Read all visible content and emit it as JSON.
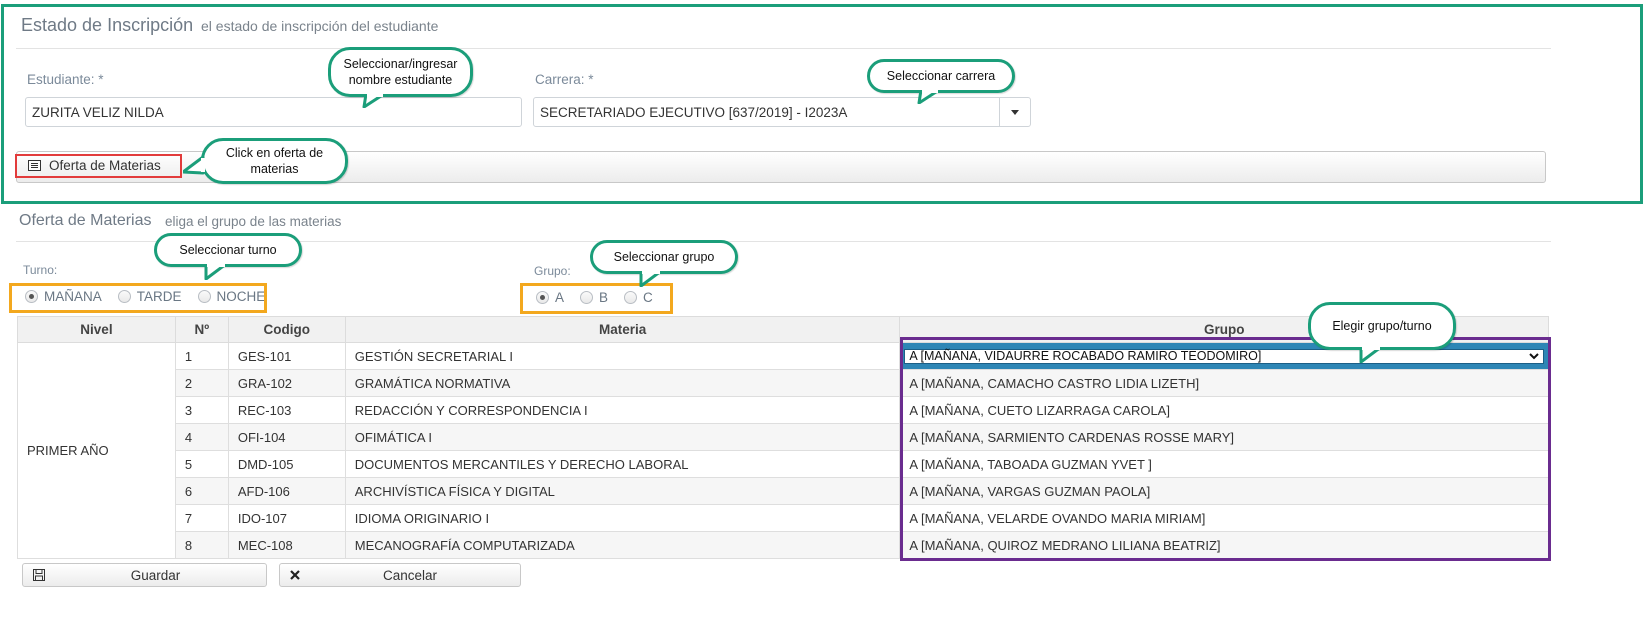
{
  "estado": {
    "title": "Estado de Inscripción",
    "subtitle": "el estado de inscripción del estudiante",
    "estudiante_label": "Estudiante: *",
    "estudiante_value": "ZURITA VELIZ NILDA",
    "carrera_label": "Carrera: *",
    "carrera_value": "SECRETARIADO EJECUTIVO [637/2019] - I2023A",
    "oferta_button": "Oferta de Materias"
  },
  "oferta": {
    "title": "Oferta de Materias",
    "subtitle": "eliga el grupo de las materias",
    "turno_label": "Turno:",
    "turnos": [
      "MAÑANA",
      "TARDE",
      "NOCHE"
    ],
    "turno_selected": "MAÑANA",
    "grupo_label": "Grupo:",
    "grupos": [
      "A",
      "B",
      "C"
    ],
    "grupo_selected": "A"
  },
  "table": {
    "headers": [
      "Nivel",
      "Nº",
      "Codigo",
      "Materia",
      "Grupo"
    ],
    "nivel": "PRIMER AÑO",
    "rows": [
      {
        "n": "1",
        "codigo": "GES-101",
        "materia": "GESTIÓN SECRETARIAL I",
        "grupo": "A [MAÑANA, VIDAURRE ROCABADO RAMIRO TEODOMIRO]"
      },
      {
        "n": "2",
        "codigo": "GRA-102",
        "materia": "GRAMÁTICA NORMATIVA",
        "grupo": "A [MAÑANA, CAMACHO CASTRO LIDIA LIZETH]"
      },
      {
        "n": "3",
        "codigo": "REC-103",
        "materia": "REDACCIÓN Y CORRESPONDENCIA I",
        "grupo": "A [MAÑANA, CUETO LIZARRAGA CAROLA]"
      },
      {
        "n": "4",
        "codigo": "OFI-104",
        "materia": "OFIMÁTICA I",
        "grupo": "A [MAÑANA, SARMIENTO CARDENAS ROSSE MARY]"
      },
      {
        "n": "5",
        "codigo": "DMD-105",
        "materia": "DOCUMENTOS MERCANTILES Y DERECHO LABORAL",
        "grupo": "A [MAÑANA, TABOADA GUZMAN YVET ]"
      },
      {
        "n": "6",
        "codigo": "AFD-106",
        "materia": "ARCHIVÍSTICA FÍSICA Y DIGITAL",
        "grupo": "A [MAÑANA, VARGAS GUZMAN PAOLA]"
      },
      {
        "n": "7",
        "codigo": "IDO-107",
        "materia": "IDIOMA ORIGINARIO I",
        "grupo": "A [MAÑANA, VELARDE OVANDO MARIA MIRIAM]"
      },
      {
        "n": "8",
        "codigo": "MEC-108",
        "materia": "MECANOGRAFÍA COMPUTARIZADA",
        "grupo": "A [MAÑANA, QUIROZ MEDRANO LILIANA BEATRIZ]"
      }
    ]
  },
  "actions": {
    "guardar": "Guardar",
    "cancelar": "Cancelar"
  },
  "callouts": {
    "estudiante": "Seleccionar/ingresar nombre estudiante",
    "carrera": "Seleccionar carrera",
    "oferta": "Click en oferta de materias",
    "turno": "Seleccionar turno",
    "grupo": "Seleccionar grupo",
    "grupo_turno": "Elegir grupo/turno"
  },
  "colors": {
    "callout_border": "#1b9e7a",
    "highlight_orange": "#f3a81e",
    "highlight_red": "#e23b3b",
    "highlight_purple": "#6a2c8f",
    "selected_row": "#2e86b5"
  },
  "icons": {
    "oferta": "list-icon",
    "dropdown": "caret-down-icon",
    "guardar": "save-icon",
    "cancelar": "close-icon"
  }
}
